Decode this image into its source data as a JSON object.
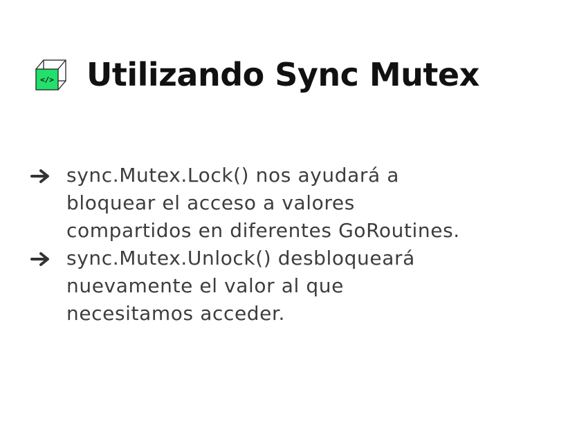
{
  "slide": {
    "title": "Utilizando Sync Mutex",
    "logo": {
      "icon": "code-cube-icon",
      "glyph": "</>",
      "accent_color": "#22e06b"
    },
    "bullets": [
      {
        "icon": "arrow-right-icon",
        "text": "sync.Mutex.Lock() nos ayudará a bloquear el acceso a valores compartidos en diferentes GoRoutines."
      },
      {
        "icon": "arrow-right-icon",
        "text": "sync.Mutex.Unlock() desbloqueará nuevamente el valor al que necesitamos acceder."
      }
    ]
  }
}
